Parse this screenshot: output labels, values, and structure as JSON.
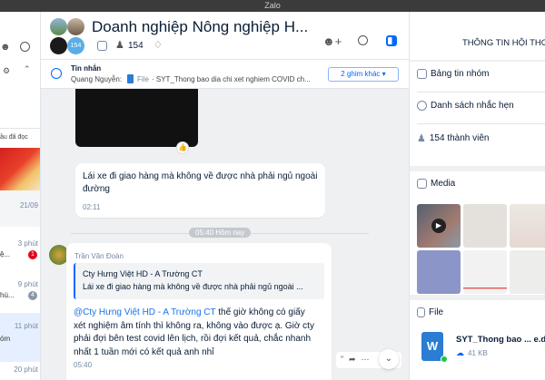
{
  "window": {
    "title": "Zalo"
  },
  "left": {
    "read_label": "ầu đã đọc",
    "items": [
      {
        "time": "21/09",
        "preview": ""
      },
      {
        "time": "3 phút",
        "preview": "ệ...",
        "badge": "1"
      },
      {
        "time": "9 phút",
        "preview": "hú...",
        "badge": "4"
      },
      {
        "time": "11 phút",
        "preview": "óm"
      },
      {
        "time": "20 phút",
        "preview": ""
      }
    ]
  },
  "header": {
    "title": "Doanh nghiệp Nông nghiệp H...",
    "avatar_count": "154",
    "member_count": "154"
  },
  "pinned": {
    "label": "Tin nhắn",
    "sender": "Quang Nguyễn:",
    "type": "File",
    "text": "· SYT_Thong bao dia chi xet nghiem COVID ch...",
    "more_button": "2 ghim khác"
  },
  "chat": {
    "messages": [
      {
        "text": "Lái xe đi giao hàng mà không về được nhà phải ngủ ngoài đường",
        "time": "02:11"
      },
      {
        "sender": "Trần Văn Đoàn",
        "quote_author": "Cty Hưng Việt HD - A Trường CT",
        "quote_text": "Lái xe đi giao hàng mà không về được nhà phải ngủ ngoài ...",
        "mention": "@Cty Hưng Việt HD - A Trường CT",
        "text": " thế giờ không có giấy xét nghiệm âm tính thì không ra, không vào được ạ. Giờ cty phải đợi bên test covid lên lịch, rồi đợi kết quả, chắc nhanh nhất 1 tuần mới có kết quả anh nhỉ",
        "time": "05:40"
      }
    ],
    "divider": "05:40 Hôm nay"
  },
  "right": {
    "title": "THÔNG TIN HỘI THO",
    "menu": [
      "Bảng tin nhóm",
      "Danh sách nhắc hẹn",
      "154 thành viên"
    ],
    "media_label": "Media",
    "file_label": "File",
    "files": [
      {
        "name": "SYT_Thong bao ... e.do",
        "size": "41 KB"
      }
    ]
  },
  "colors": {
    "accent": "#0068ff",
    "mention": "#1a73e8",
    "badge_red": "#e5001a",
    "chat_bg": "#eef0f1"
  }
}
